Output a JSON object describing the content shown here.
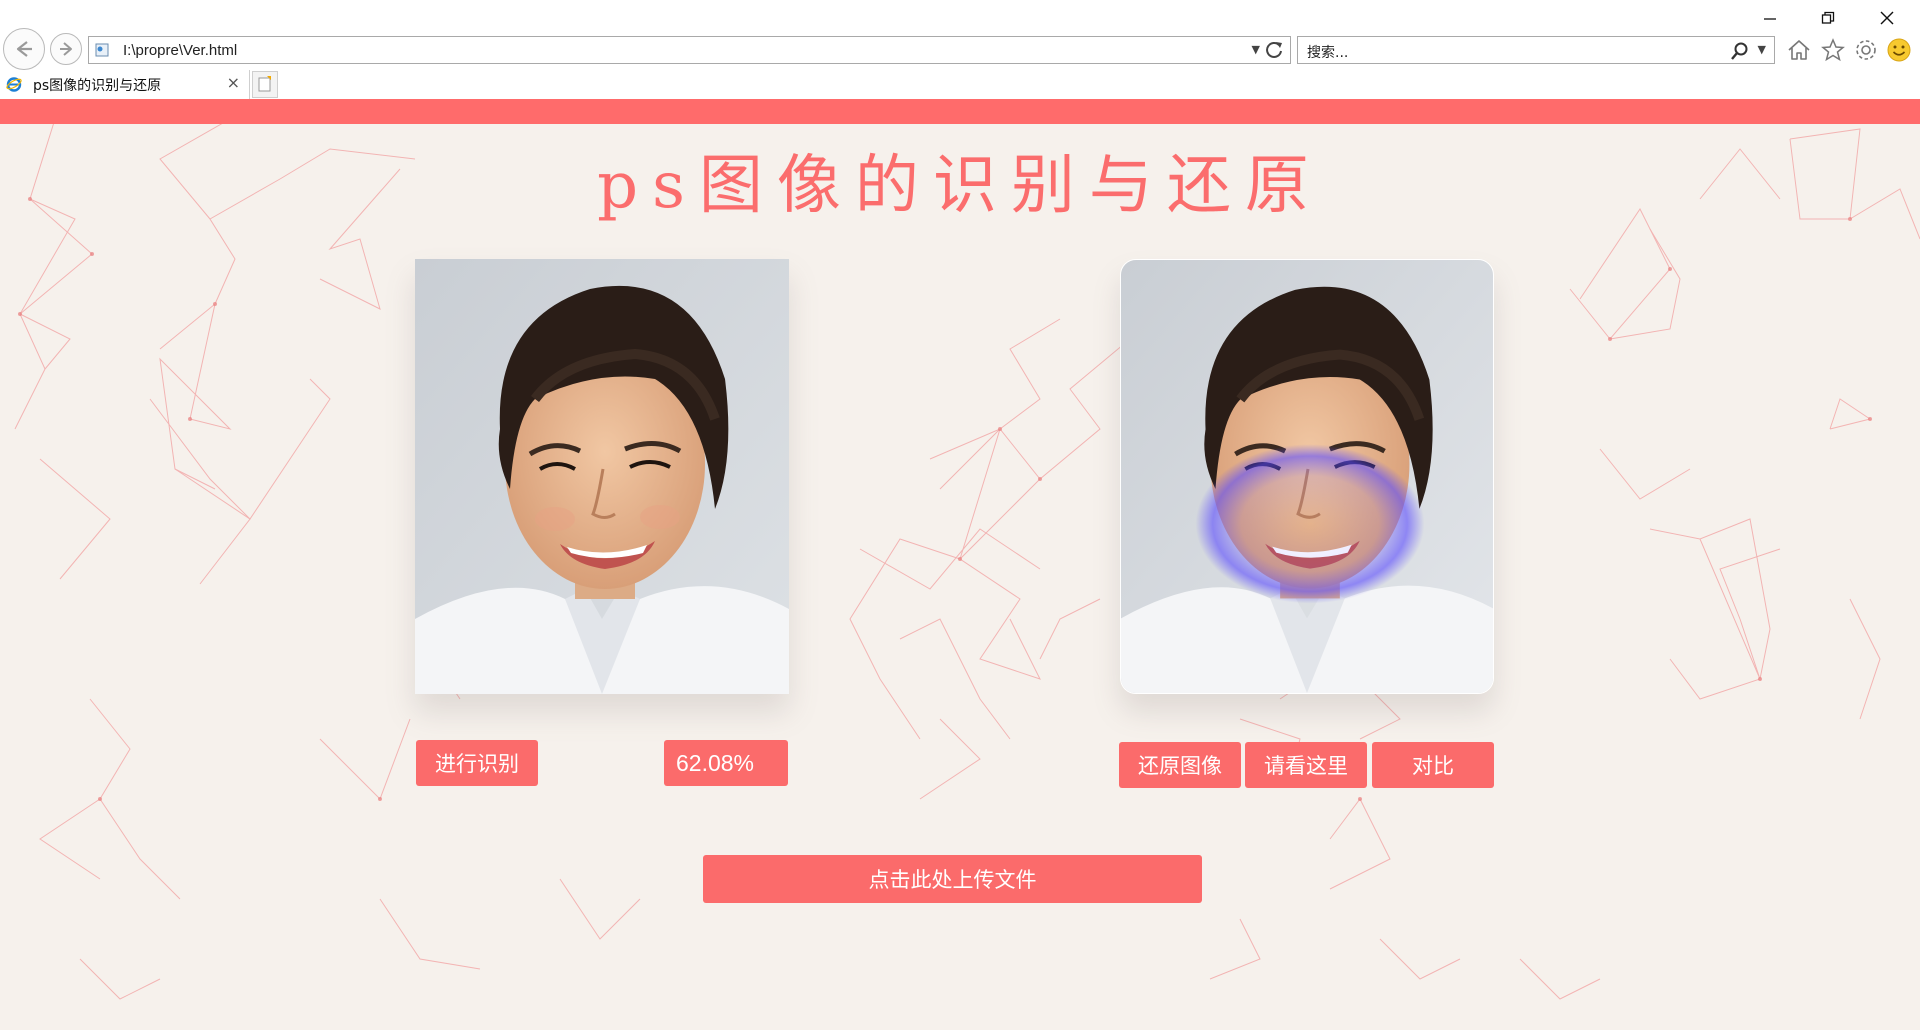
{
  "browser": {
    "url": "I:\\propre\\Ver.html",
    "search_placeholder": "搜索...",
    "tab_title": "ps图像的识别与还原",
    "tab_close": "×"
  },
  "page": {
    "title": "ps图像的识别与还原",
    "left_panel": {
      "recognize_label": "进行识别",
      "score": "62.08%"
    },
    "right_panel": {
      "restore_label": "还原图像",
      "look_label": "请看这里",
      "compare_label": "对比"
    },
    "upload_label": "点击此处上传文件"
  },
  "colors": {
    "accent": "#fb6b6b",
    "background": "#f6f1ec",
    "network_lines": "#f2a5a5",
    "heatmap": "#6a5cff"
  }
}
